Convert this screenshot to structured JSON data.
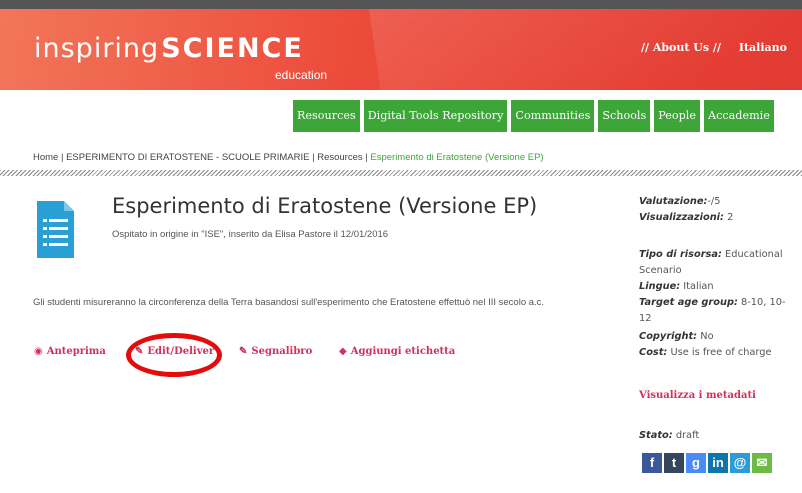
{
  "header": {
    "logo_part1": "inspiring",
    "logo_part2": "SCIENCE",
    "logo_part3": "education",
    "about": "// About Us //",
    "language": "Italiano"
  },
  "nav": {
    "items": [
      {
        "label": "Resources"
      },
      {
        "label": "Digital Tools Repository"
      },
      {
        "label": "Communities"
      },
      {
        "label": "Schools"
      },
      {
        "label": "People"
      },
      {
        "label": "Accademie"
      }
    ]
  },
  "breadcrumb": {
    "home": "Home",
    "parent": "ESPERIMENTO DI ERATOSTENE - SCUOLE PRIMARIE",
    "section": "Resources",
    "current": "Esperimento di Eratostene (Versione EP)"
  },
  "resource": {
    "title": "Esperimento di Eratostene (Versione EP)",
    "subtitle": "Ospitato in origine in \"ISE\", inserito da Elisa Pastore il 12/01/2016",
    "description": "Gli studenti misureranno la circonferenza della Terra basandosi sull'esperimento che Eratostene effettuò nel III secolo a.c."
  },
  "actions": {
    "preview": "Anteprima",
    "edit": "Edit/Deliver",
    "bookmark": "Segnalibro",
    "tag": "Aggiungi etichetta"
  },
  "sidebar": {
    "rating_label": "Valutazione:",
    "rating_value": "-/5",
    "views_label": "Visualizzazioni:",
    "views_value": "2",
    "type_label": "Tipo di risorsa:",
    "type_value": "Educational Scenario",
    "lang_label": "Lingue:",
    "lang_value": "Italian",
    "age_label": "Target age group:",
    "age_value": "8-10, 10-12",
    "copyright_label": "Copyright:",
    "copyright_value": "No",
    "cost_label": "Cost:",
    "cost_value": "Use is free of charge",
    "metadata_link": "Visualizza i metadati",
    "status_label": "Stato:",
    "status_value": "draft"
  },
  "social": [
    {
      "icon": "facebook-icon",
      "glyph": "f",
      "color": "#3b5998"
    },
    {
      "icon": "tumblr-icon",
      "glyph": "t",
      "color": "#35465c"
    },
    {
      "icon": "google-icon",
      "glyph": "g",
      "color": "#4c8bf5"
    },
    {
      "icon": "linkedin-icon",
      "glyph": "in",
      "color": "#0e76a8"
    },
    {
      "icon": "email-at-icon",
      "glyph": "@",
      "color": "#2d9bd6"
    },
    {
      "icon": "mail-icon",
      "glyph": "✉",
      "color": "#6dbb45"
    }
  ],
  "colors": {
    "accent_green": "#3ea539",
    "link_pink": "#d1305a",
    "highlight_red": "#e30b0b"
  }
}
